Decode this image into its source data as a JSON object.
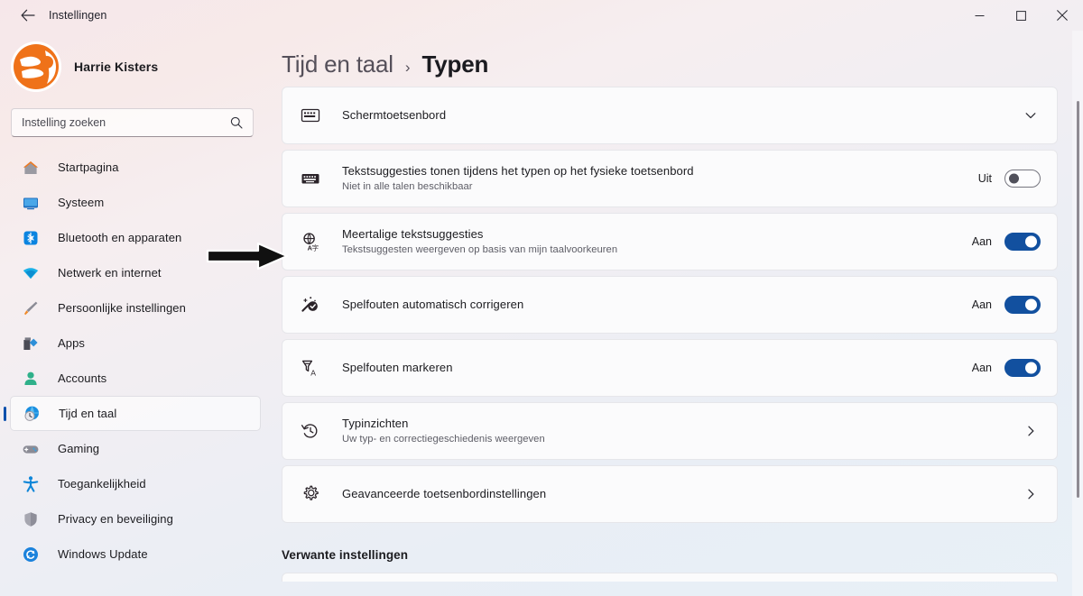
{
  "window": {
    "title": "Instellingen",
    "back_icon": "arrow-left-icon",
    "controls": {
      "minimize": "minimize-icon",
      "maximize": "maximize-icon",
      "close": "close-icon"
    }
  },
  "account": {
    "name": "Harrie Kisters",
    "avatar_icon": "user-avatar"
  },
  "search": {
    "placeholder": "Instelling zoeken",
    "value": "",
    "icon": "search-icon"
  },
  "sidebar": {
    "items": [
      {
        "label": "Startpagina",
        "icon": "home-icon",
        "active": false
      },
      {
        "label": "Systeem",
        "icon": "monitor-icon",
        "active": false
      },
      {
        "label": "Bluetooth en apparaten",
        "icon": "bluetooth-icon",
        "active": false
      },
      {
        "label": "Netwerk en internet",
        "icon": "wifi-icon",
        "active": false
      },
      {
        "label": "Persoonlijke instellingen",
        "icon": "paintbrush-icon",
        "active": false
      },
      {
        "label": "Apps",
        "icon": "apps-icon",
        "active": false
      },
      {
        "label": "Accounts",
        "icon": "person-icon",
        "active": false
      },
      {
        "label": "Tijd en taal",
        "icon": "clock-globe-icon",
        "active": true
      },
      {
        "label": "Gaming",
        "icon": "gamepad-icon",
        "active": false
      },
      {
        "label": "Toegankelijkheid",
        "icon": "accessibility-icon",
        "active": false
      },
      {
        "label": "Privacy en beveiliging",
        "icon": "shield-icon",
        "active": false
      },
      {
        "label": "Windows Update",
        "icon": "update-icon",
        "active": false
      }
    ]
  },
  "breadcrumb": {
    "parent": "Tijd en taal",
    "separator": "›",
    "current": "Typen"
  },
  "settings": [
    {
      "title": "Schermtoetsenbord",
      "subtitle": "",
      "icon": "onscreen-keyboard-icon",
      "control": "chevron-down",
      "state_label": ""
    },
    {
      "title": "Tekstsuggesties tonen tijdens het typen op het fysieke toetsenbord",
      "subtitle": "Niet in alle talen beschikbaar",
      "icon": "keyboard-icon",
      "control": "toggle-off",
      "state_label": "Uit"
    },
    {
      "title": "Meertalige tekstsuggesties",
      "subtitle": "Tekstsuggesten weergeven op basis van mijn taalvoorkeuren",
      "icon": "globe-language-icon",
      "control": "toggle-on",
      "state_label": "Aan"
    },
    {
      "title": "Spelfouten automatisch corrigeren",
      "subtitle": "",
      "icon": "autocorrect-wand-icon",
      "control": "toggle-on",
      "state_label": "Aan"
    },
    {
      "title": "Spelfouten markeren",
      "subtitle": "",
      "icon": "spellcheck-icon",
      "control": "toggle-on",
      "state_label": "Aan"
    },
    {
      "title": "Typinzichten",
      "subtitle": "Uw typ- en correctiegeschiedenis weergeven",
      "icon": "history-icon",
      "control": "chevron-right",
      "state_label": ""
    },
    {
      "title": "Geavanceerde toetsenbordinstellingen",
      "subtitle": "",
      "icon": "gear-icon",
      "control": "chevron-right",
      "state_label": ""
    }
  ],
  "related": {
    "heading": "Verwante instellingen"
  },
  "annotation": {
    "arrow": "black-pointer-arrow",
    "points_to": "Meertalige tekstsuggesties"
  },
  "colors": {
    "accent_blue": "#12509f",
    "selection_bar": "#0b50ac",
    "card_bg": "#fbfbfc",
    "card_border": "#e6e6ea"
  }
}
